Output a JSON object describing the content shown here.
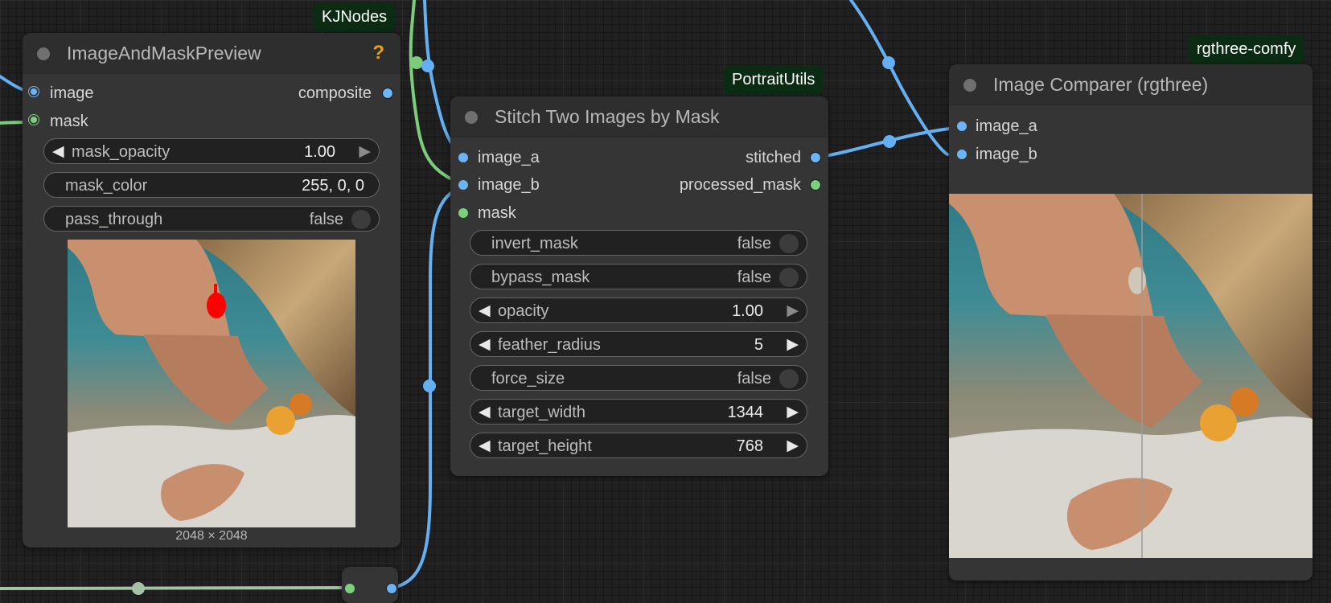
{
  "colors": {
    "image_slot": "#6cb4f4",
    "mask_slot": "#7cd07c",
    "wire_image": "#64b0f2",
    "wire_mask": "#7ccc7c",
    "badge_bg": "#0b2c12",
    "help": "#f0a000"
  },
  "badges": {
    "kjnodes": "KJNodes",
    "portrait_utils": "PortraitUtils",
    "rgthree": "rgthree-comfy"
  },
  "node_preview": {
    "title": "ImageAndMaskPreview",
    "help_glyph": "?",
    "inputs": [
      "image",
      "mask"
    ],
    "output": "composite",
    "widgets": [
      {
        "name": "mask_opacity",
        "value": "1.00"
      },
      {
        "name": "mask_color",
        "value": "255, 0, 0"
      },
      {
        "name": "pass_through",
        "value": "false"
      }
    ],
    "image_size": "2048 × 2048"
  },
  "node_stitch": {
    "title": "Stitch Two Images by Mask",
    "inputs": [
      "image_a",
      "image_b",
      "mask"
    ],
    "outputs": [
      "stitched",
      "processed_mask"
    ],
    "widgets": [
      {
        "name": "invert_mask",
        "value": "false"
      },
      {
        "name": "bypass_mask",
        "value": "false"
      },
      {
        "name": "opacity",
        "value": "1.00"
      },
      {
        "name": "feather_radius",
        "value": "5"
      },
      {
        "name": "force_size",
        "value": "false"
      },
      {
        "name": "target_width",
        "value": "1344"
      },
      {
        "name": "target_height",
        "value": "768"
      }
    ]
  },
  "node_comparer": {
    "title": "Image Comparer (rgthree)",
    "inputs": [
      "image_a",
      "image_b"
    ]
  },
  "arrows": {
    "left": "◀",
    "right": "▶"
  }
}
